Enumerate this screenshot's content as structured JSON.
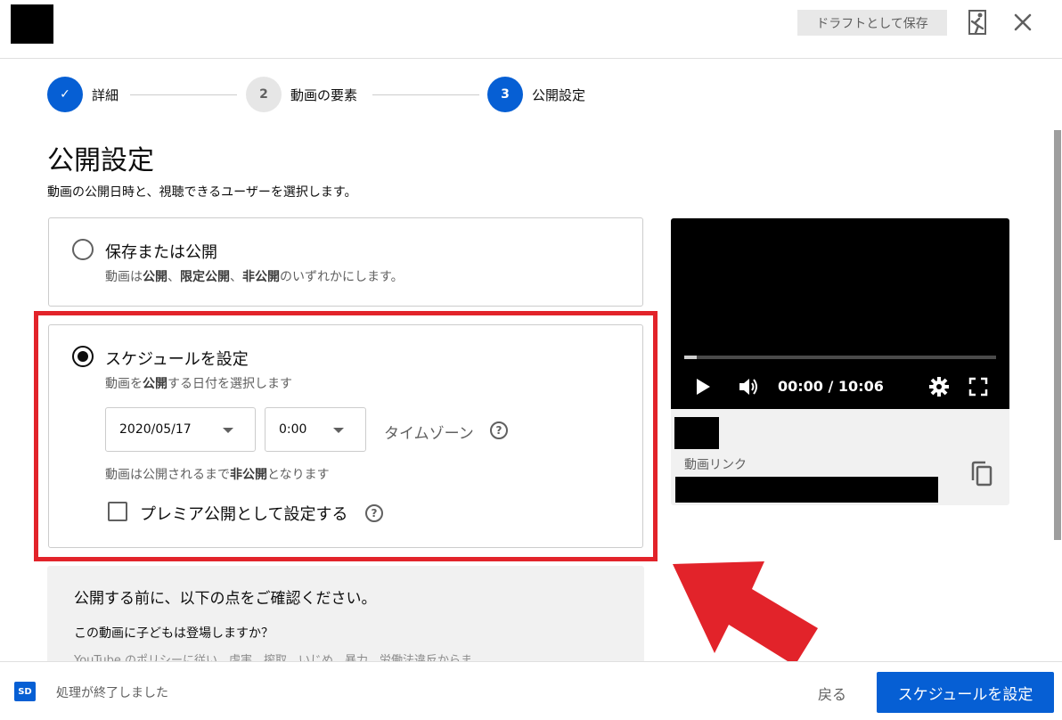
{
  "header": {
    "draft_label": "ドラフトとして保存"
  },
  "stepper": {
    "steps": [
      {
        "number": "✓",
        "label": "詳細",
        "state": "done"
      },
      {
        "number": "2",
        "label": "動画の要素",
        "state": "idle"
      },
      {
        "number": "3",
        "label": "公開設定",
        "state": "active"
      }
    ]
  },
  "page": {
    "title": "公開設定",
    "subtitle": "動画の公開日時と、視聴できるユーザーを選択します。"
  },
  "options": {
    "save_publish": {
      "title": "保存または公開",
      "desc_parts": [
        "動画は",
        "公開",
        "、",
        "限定公開",
        "、",
        "非公開",
        "のいずれかにします。"
      ],
      "selected": false
    },
    "schedule": {
      "title": "スケジュールを設定",
      "desc_parts": [
        "動画を",
        "公開",
        "する日付を選択します"
      ],
      "selected": true,
      "date_value": "2020/05/17",
      "time_value": "0:00",
      "timezone_label": "タイムゾーン",
      "note_parts": [
        "動画は公開されるまで",
        "非公開",
        "となります"
      ],
      "premiere_label": "プレミア公開として設定する",
      "premiere_checked": false
    }
  },
  "info_box": {
    "heading": "公開する前に、以下の点をご確認ください。",
    "question": "この動画に子どもは登場しますか？",
    "truncated_text": "YouTube のポリシーに従い、虐害、搾取、いじめ、暴力、労働法違反からま"
  },
  "preview": {
    "time_display": "00:00 / 10:06",
    "progress": 0.04,
    "link_label": "動画リンク"
  },
  "footer": {
    "quality_badge": "SD",
    "status": "処理が終了しました",
    "back_label": "戻る",
    "schedule_label": "スケジュールを設定"
  },
  "colors": {
    "accent": "#065fd4",
    "annotation_red": "#e2232a"
  }
}
